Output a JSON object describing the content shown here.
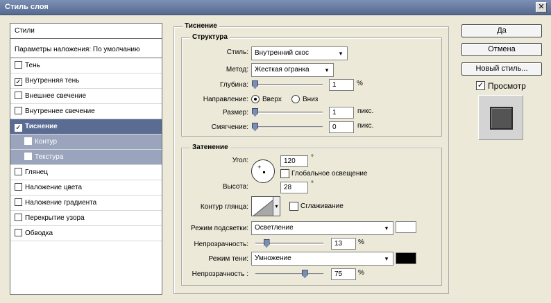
{
  "window": {
    "title": "Стиль слоя",
    "close": "✕"
  },
  "styles_list": {
    "header": "Стили",
    "blend_options": "Параметры наложения: По умолчанию",
    "items": [
      {
        "label": "Тень",
        "checked": false
      },
      {
        "label": "Внутренняя тень",
        "checked": true
      },
      {
        "label": "Внешнее свечение",
        "checked": false
      },
      {
        "label": "Внутреннее свечение",
        "checked": false
      },
      {
        "label": "Тиснение",
        "checked": true
      },
      {
        "label": "Контур",
        "checked": false
      },
      {
        "label": "Текстура",
        "checked": false
      },
      {
        "label": "Глянец",
        "checked": false
      },
      {
        "label": "Наложение цвета",
        "checked": false
      },
      {
        "label": "Наложение градиента",
        "checked": false
      },
      {
        "label": "Перекрытие узора",
        "checked": false
      },
      {
        "label": "Обводка",
        "checked": false
      }
    ]
  },
  "emboss": {
    "title": "Тиснение",
    "structure": {
      "title": "Структура",
      "style_label": "Стиль:",
      "style_value": "Внутренний скос",
      "method_label": "Метод:",
      "method_value": "Жесткая огранка",
      "depth_label": "Глубина:",
      "depth_value": "1",
      "depth_unit": "%",
      "depth_slider": 0.0,
      "direction_label": "Направление:",
      "direction_up": "Вверх",
      "direction_down": "Вниз",
      "size_label": "Размер:",
      "size_value": "1",
      "size_unit": "пикс.",
      "size_slider": 0.0,
      "soften_label": "Смягчение:",
      "soften_value": "0",
      "soften_unit": "пикс.",
      "soften_slider": 0.0
    },
    "shading": {
      "title": "Затенение",
      "angle_label": "Угол:",
      "angle_value": "120",
      "angle_unit": "°",
      "global_light_label": "Глобальное освещение",
      "global_light_checked": false,
      "altitude_label": "Высота:",
      "altitude_value": "28",
      "altitude_unit": "°",
      "gloss_contour_label": "Контур глянца:",
      "antialias_label": "Сглаживание",
      "antialias_checked": false,
      "highlight_mode_label": "Режим подсветки:",
      "highlight_mode_value": "Осветление",
      "highlight_color": "#ffffff",
      "highlight_opacity_label": "Непрозрачность:",
      "highlight_opacity_value": "13",
      "highlight_opacity_unit": "%",
      "highlight_opacity_slider": 0.13,
      "shadow_mode_label": "Режим тени:",
      "shadow_mode_value": "Умножение",
      "shadow_color": "#000000",
      "shadow_opacity_label": "Непрозрачность :",
      "shadow_opacity_value": "75",
      "shadow_opacity_unit": "%",
      "shadow_opacity_slider": 0.75
    }
  },
  "buttons": {
    "ok": "Да",
    "cancel": "Отмена",
    "new_style": "Новый стиль..."
  },
  "preview": {
    "label": "Просмотр",
    "checked": true
  },
  "icons": {
    "dropdown": "▾",
    "check": "✓",
    "crosshair": "+"
  }
}
